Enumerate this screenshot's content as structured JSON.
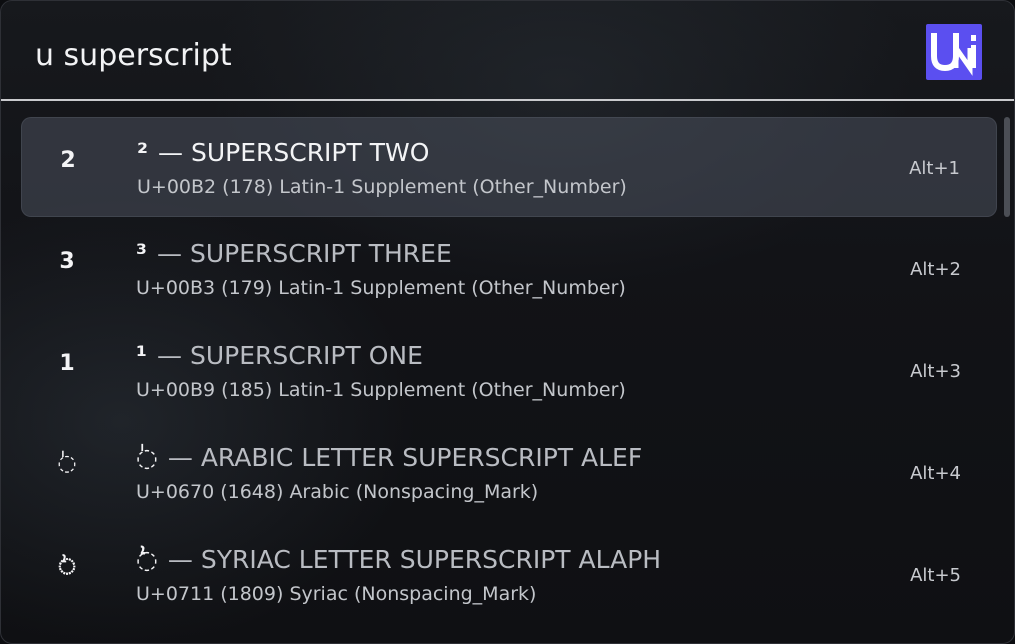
{
  "search": {
    "value": "u superscript",
    "placeholder": ""
  },
  "logo": {
    "text": "UNI",
    "color": "#5b4ff0"
  },
  "results": [
    {
      "glyph": "2",
      "char": "²",
      "name": "SUPERSCRIPT TWO",
      "info": "U+00B2 (178) Latin-1 Supplement (Other_Number)",
      "shortcut": "Alt+1",
      "selected": true
    },
    {
      "glyph": "3",
      "char": "³",
      "name": "SUPERSCRIPT THREE",
      "info": "U+00B3 (179) Latin-1 Supplement (Other_Number)",
      "shortcut": "Alt+2",
      "selected": false
    },
    {
      "glyph": "1",
      "char": "¹",
      "name": "SUPERSCRIPT ONE",
      "info": "U+00B9 (185) Latin-1 Supplement (Other_Number)",
      "shortcut": "Alt+3",
      "selected": false
    },
    {
      "glyph": "◌ٰ",
      "char": "◌ٰ",
      "name": "ARABIC LETTER SUPERSCRIPT ALEF",
      "info": "U+0670 (1648) Arabic (Nonspacing_Mark)",
      "shortcut": "Alt+4",
      "selected": false
    },
    {
      "glyph": "◌ܑ",
      "char": "ܑ◌",
      "name": "SYRIAC LETTER SUPERSCRIPT ALAPH",
      "info": "U+0711 (1809) Syriac (Nonspacing_Mark)",
      "shortcut": "Alt+5",
      "selected": false
    }
  ],
  "dash": "—"
}
